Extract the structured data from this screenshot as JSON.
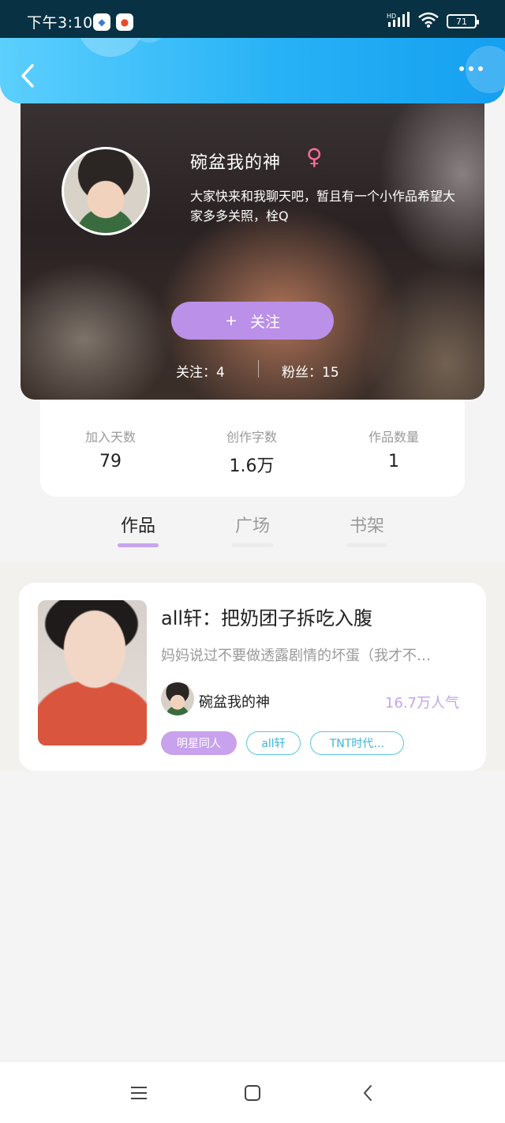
{
  "status_bar": {
    "time": "下午3:10",
    "network": "HD",
    "battery": "71"
  },
  "header": {
    "back_icon": "chevron-left-icon",
    "more_icon": "more-dots-icon"
  },
  "profile": {
    "name": "碗盆我的神",
    "gender_symbol": "♀",
    "bio": "大家快来和我聊天吧，暂且有一个小作品希望大家多多关照，栓Q",
    "follow_button": "关注",
    "follow_plus": "+",
    "following_label": "关注：4",
    "fans_label": "粉丝：15"
  },
  "stats": [
    {
      "label": "加入天数",
      "value": "79"
    },
    {
      "label": "创作字数",
      "value": "1.6万"
    },
    {
      "label": "作品数量",
      "value": "1"
    }
  ],
  "tabs": [
    {
      "label": "作品",
      "active": true
    },
    {
      "label": "广场",
      "active": false
    },
    {
      "label": "书架",
      "active": false
    }
  ],
  "works": [
    {
      "title": "all轩：把奶团子拆吃入腹",
      "description": "妈妈说过不要做透露剧情的坏蛋（我才不…",
      "author": "碗盆我的神",
      "popularity": "16.7万人气",
      "tags": [
        "明星同人",
        "all轩",
        "TNT时代…"
      ]
    }
  ],
  "colors": {
    "header_gradient_start": "#5ccffd",
    "header_gradient_end": "#159ff0",
    "accent_purple": "#bb90e8",
    "tag_cyan": "#5ac8df",
    "gender_pink": "#ff6b9d"
  }
}
